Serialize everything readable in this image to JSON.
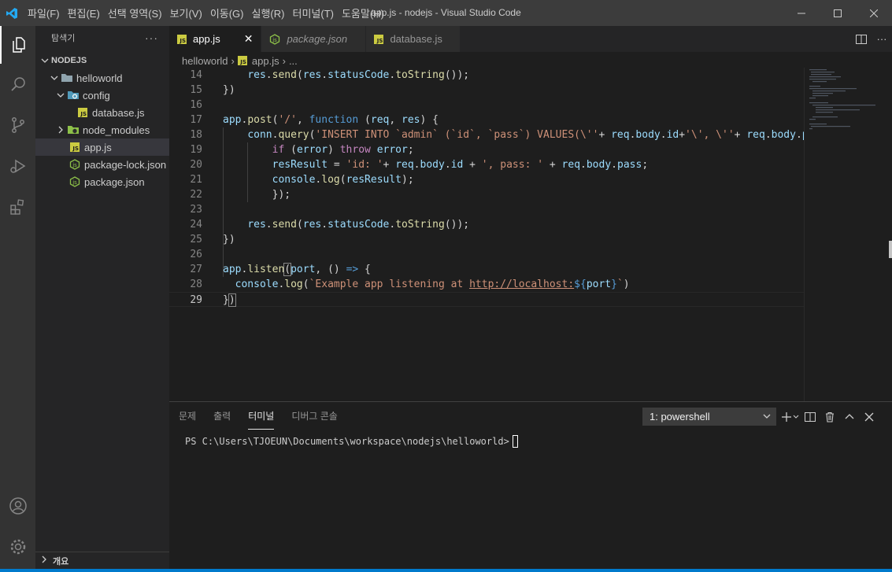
{
  "window": {
    "title": "app.js - nodejs - Visual Studio Code"
  },
  "menu": [
    "파일(F)",
    "편집(E)",
    "선택 영역(S)",
    "보기(V)",
    "이동(G)",
    "실행(R)",
    "터미널(T)",
    "도움말(H)"
  ],
  "sidebar": {
    "title": "탐색기",
    "root": "NODEJS",
    "items": [
      {
        "label": "helloworld",
        "kind": "folder"
      },
      {
        "label": "config",
        "kind": "config-folder"
      },
      {
        "label": "database.js",
        "kind": "js"
      },
      {
        "label": "node_modules",
        "kind": "node-folder"
      },
      {
        "label": "app.js",
        "kind": "js"
      },
      {
        "label": "package-lock.json",
        "kind": "json"
      },
      {
        "label": "package.json",
        "kind": "json"
      }
    ],
    "outline_label": "개요"
  },
  "tabs": [
    {
      "label": "app.js",
      "active": true
    },
    {
      "label": "package.json",
      "active": false
    },
    {
      "label": "database.js",
      "active": false
    }
  ],
  "breadcrumb": {
    "folder": "helloworld",
    "file": "app.js",
    "more": "..."
  },
  "editor": {
    "current_line": "29",
    "lines": [
      {
        "n": "14"
      },
      {
        "n": "15"
      },
      {
        "n": "16"
      },
      {
        "n": "17"
      },
      {
        "n": "18"
      },
      {
        "n": "19"
      },
      {
        "n": "20"
      },
      {
        "n": "21"
      },
      {
        "n": "22"
      },
      {
        "n": "23"
      },
      {
        "n": "24"
      },
      {
        "n": "25"
      },
      {
        "n": "26"
      },
      {
        "n": "27"
      },
      {
        "n": "28"
      },
      {
        "n": "29"
      }
    ]
  },
  "panel": {
    "tabs": [
      "문제",
      "출력",
      "터미널",
      "디버그 콘솔"
    ],
    "active_tab": "터미널",
    "shell_selected": "1: powershell",
    "prompt": "PS C:\\Users\\TJOEUN\\Documents\\workspace\\nodejs\\helloworld>"
  },
  "colors": {
    "accent": "#007acc",
    "js_icon": "#cbcb41",
    "json_icon": "#8dc149",
    "config_icon": "#519aba"
  }
}
